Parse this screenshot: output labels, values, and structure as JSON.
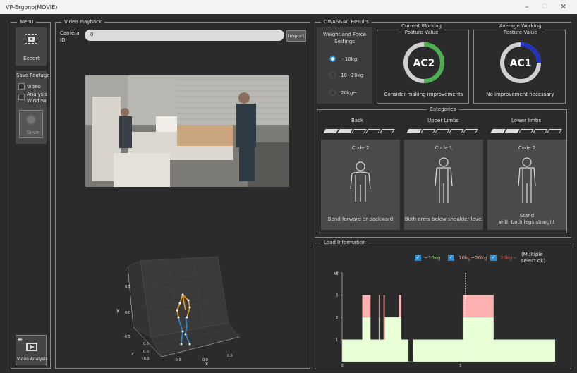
{
  "window": {
    "title": "VP-Ergono(MOVIE)",
    "minimize": "–",
    "maximize": "☐",
    "close": "✕"
  },
  "menu": {
    "title": "Menu",
    "export_label": "Export",
    "save_footage_title": "Save Footage",
    "video_label": "Video",
    "analysis_window_label": "Analysis\nWindow",
    "save_label": "Save",
    "video_analysis_label": "Video Analysis"
  },
  "playback": {
    "title": "Video Playback",
    "camera_id_label": "Camera\nID",
    "camera_id_value": "0",
    "import_label": "Import"
  },
  "plot3d": {
    "ylabel": "y",
    "zlabel": "z",
    "xlabel": "x",
    "y_ticks": [
      "0.5",
      "0.0",
      "-0.5"
    ],
    "z_ticks": [
      "0.5",
      "0.0",
      "-0.5"
    ],
    "x_ticks": [
      "-0.5",
      "0.0",
      "0.5"
    ]
  },
  "owas": {
    "title": "OWAS&AC Results",
    "weight_title": "Weight and Force\nSettings",
    "weights": [
      {
        "label": "~10kg",
        "selected": true
      },
      {
        "label": "10~20kg",
        "selected": false
      },
      {
        "label": "20kg~",
        "selected": false
      }
    ],
    "current": {
      "title": "Current Working\nPosture Value",
      "code": "AC2",
      "message": "Consider making improvements",
      "fraction": 0.5,
      "color": "#4caf50"
    },
    "average": {
      "title": "Average Working\nPosture Value",
      "code": "AC1",
      "message": "No improvement necessary",
      "fraction": 0.25,
      "color": "#2233bb"
    }
  },
  "categories": {
    "title": "Categories",
    "items": [
      {
        "name": "Back",
        "code": "Code 2",
        "desc": "Bend forward or backward",
        "level": 2
      },
      {
        "name": "Upper Limbs",
        "code": "Code 1",
        "desc": "Both arms below shoulder level",
        "level": 1
      },
      {
        "name": "Lower limbs",
        "code": "Code 2",
        "desc": "Stand\nwith both legs straight",
        "level": 2
      }
    ]
  },
  "load": {
    "title": "Load Information",
    "legend": [
      {
        "label": "~10kg",
        "color": "#8fd17e"
      },
      {
        "label": "10kg~20kg",
        "color": "#f4a98a"
      },
      {
        "label": "20kg~",
        "color": "#e05050"
      }
    ],
    "multi_note": "(Multiple\nselect ok)",
    "chart_data": {
      "type": "area",
      "ylabel": "AC",
      "ylim": [
        0,
        4
      ],
      "xlim": [
        0,
        9
      ],
      "y_ticks": [
        1,
        2,
        3,
        4
      ],
      "x_ticks": [
        0,
        5
      ],
      "cursor_x": 5.2,
      "series": [
        {
          "name": "~10kg",
          "color": "#e8ffd8",
          "x": [
            0,
            0.75,
            0.85,
            1.1,
            1.2,
            1.5,
            1.55,
            1.6,
            1.75,
            1.8,
            2.4,
            2.5,
            2.75,
            2.8,
            3.0,
            5.0,
            5.1,
            6.3,
            6.4,
            9
          ],
          "y": [
            1,
            1,
            2,
            2,
            1,
            1,
            2,
            1,
            1,
            2,
            2,
            1,
            1,
            0,
            1,
            1,
            2,
            2,
            1,
            1
          ]
        },
        {
          "name": "10kg~20kg",
          "color": "#ffb0b0",
          "x": [
            0.8,
            0.85,
            1.1,
            1.2,
            1.55,
            1.6,
            1.75,
            1.8,
            2.35,
            2.4,
            2.5,
            5.0,
            5.1,
            6.3,
            6.4
          ],
          "y": [
            0,
            3,
            3,
            0,
            3,
            0,
            3,
            0,
            0,
            3,
            0,
            0,
            3,
            3,
            0
          ]
        }
      ]
    }
  },
  "colors": {
    "accent": "#2a8bd6",
    "background": "#2b2b2b",
    "panel": "#3c3c3c"
  },
  "icons": {
    "camera": "camera-icon",
    "video": "video-analysis-icon",
    "person": "person-outline-icon"
  }
}
